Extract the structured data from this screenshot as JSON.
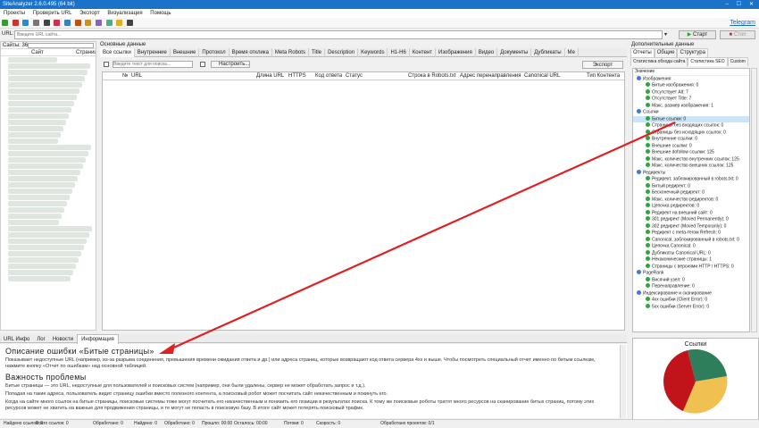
{
  "window": {
    "title": "SiteAnalyzer 2.6.0.495 (64 bit)"
  },
  "menu": [
    "Проекты",
    "Проверить URL",
    "Экспорт",
    "Визуализация",
    "Помощь"
  ],
  "toolbar": {
    "telegram": "Telegram"
  },
  "urlbar": {
    "label": "URL:",
    "placeholder": "Введите URL сайта...",
    "start": "Старт",
    "stop": "Стоп"
  },
  "sidebar": {
    "count_label": "Сайты: 36",
    "col_site": "Сайт",
    "col_pages": "Страниц"
  },
  "main": {
    "section": "Основные данные",
    "tabs": [
      "Все ссылки",
      "Внутренние",
      "Внешние",
      "Протокол",
      "Время отклика",
      "Meta Robots",
      "Title",
      "Description",
      "Keywords",
      "H1-H6",
      "Контент",
      "Изображения",
      "Видео",
      "Документы",
      "Дубликаты",
      "Ме"
    ],
    "filter_placeholder": "Введите текст для поиска...",
    "configure": "Настроить...",
    "export": "Экспорт",
    "columns": [
      "№",
      "URL",
      "Длина URL",
      "HTTPS",
      "Код ответа",
      "Статус",
      "Строка в Robots.txt",
      "Адрес перенаправления",
      "Canonical URL",
      "Тип Контента"
    ]
  },
  "right": {
    "section": "Дополнительные данные",
    "tabs1": [
      "Отчеты",
      "Общие",
      "Структура"
    ],
    "tabs2": [
      "Статистика обхода сайта",
      "Статистика SEO",
      "Custom"
    ],
    "tree_header": "Значение",
    "tree": [
      {
        "t": "Изображения",
        "lvl": 0
      },
      {
        "t": "Битые изображения: 0",
        "lvl": 1
      },
      {
        "t": "Отсутствует Alt: 7",
        "lvl": 1
      },
      {
        "t": "Отсутствует Title: 7",
        "lvl": 1
      },
      {
        "t": "Макс. размер изображения: 1",
        "lvl": 1
      },
      {
        "t": "Ссылки",
        "lvl": 0
      },
      {
        "t": "Битые ссылки: 0",
        "lvl": 1
      },
      {
        "t": "Страницы без входящих ссылок: 0",
        "lvl": 1
      },
      {
        "t": "Страницы без исходящих ссылок: 0",
        "lvl": 1
      },
      {
        "t": "Внутренние ссылки: 0",
        "lvl": 1
      },
      {
        "t": "Внешние ссылки: 0",
        "lvl": 1
      },
      {
        "t": "Внешние dofollow ссылки: 125",
        "lvl": 1
      },
      {
        "t": "Макс. количество внутренних ссылок: 125",
        "lvl": 1
      },
      {
        "t": "Макс. количество внешних ссылок: 125",
        "lvl": 1
      },
      {
        "t": "Редиректы",
        "lvl": 0
      },
      {
        "t": "Редирект, заблокированный в robots.txt: 0",
        "lvl": 1
      },
      {
        "t": "Битый редирект: 0",
        "lvl": 1
      },
      {
        "t": "Бесконечный редирект: 0",
        "lvl": 1
      },
      {
        "t": "Макс. количество редиректов: 0",
        "lvl": 1
      },
      {
        "t": "Цепочка редиректов: 0",
        "lvl": 1
      },
      {
        "t": "Редирект на внешний сайт: 0",
        "lvl": 1
      },
      {
        "t": "301 редирект (Moved Permanently): 0",
        "lvl": 1
      },
      {
        "t": "302 редирект (Moved Temporarily): 0",
        "lvl": 1
      },
      {
        "t": "Редирект с meta-тегом Refresh: 0",
        "lvl": 1
      },
      {
        "t": "Canonical, заблокированный в robots.txt: 0",
        "lvl": 1
      },
      {
        "t": "Цепочка Canonical: 0",
        "lvl": 1
      },
      {
        "t": "Дубликаты Canonical URL: 0",
        "lvl": 1
      },
      {
        "t": "Некаконические страницы: 1",
        "lvl": 1
      },
      {
        "t": "Страницы с версиями HTTP / HTTPS: 0",
        "lvl": 1
      },
      {
        "t": "PageRank",
        "lvl": 0
      },
      {
        "t": "Висячий узел: 0",
        "lvl": 1
      },
      {
        "t": "Перенаправление: 0",
        "lvl": 1
      },
      {
        "t": "Индексирование и сканирование",
        "lvl": 0
      },
      {
        "t": "4xx ошибки (Client Error): 0",
        "lvl": 1
      },
      {
        "t": "5xx ошибки (Server Error): 0",
        "lvl": 1
      }
    ],
    "pie_title": "Ссылки",
    "pie_colors": [
      "#2e7d5b",
      "#f0c050",
      "#c0141a"
    ]
  },
  "bottom": {
    "tabs": [
      "URL Инфо",
      "Лог",
      "Новости",
      "Информация"
    ],
    "heading1": "Описание ошибки «Битые страницы»",
    "para1": "Показывает недоступные URL (например, из-за разрыва соединения, превышения времени ожидания ответа и др.) или адреса страниц, которые возвращают код ответа сервера 4xx и выше. Чтобы посмотреть специальный отчет именно по битым ссылкам, нажмите кнопку «Отчет по ошибкам» над основной таблицей.",
    "heading2": "Важность проблемы",
    "para2": "Битые страницы — это URL, недоступные для пользователей и поисковых систем (например, они были удалены, сервер не может обработать запрос и т.д.).",
    "para3": "Попадая на такие адреса, пользователь видит страницу ошибки вместо полезного контента, а поисковый робот может посчитать сайт некачественным и покинуть его.",
    "para4": "Когда на сайте много ссылок на битые страницы, поисковые системы тоже могут посчитать его некачественным и понизить его позиции в результатах поиска. К тому же поисковые роботы тратят много ресурсов на сканирование битых страниц, потому этих ресурсов может не хватить на важные для продвижения страницы, и те могут не попасть в поисковую базу. В итоге сайт может потерять поисковый трафик."
  },
  "status": [
    "Найдено ссылок: 0",
    "Всего ссылок: 0",
    "Обработано: 0",
    "Найдено: 0",
    "Обработано: 0",
    "Прошло: 00:00",
    "Осталось: 00:00",
    "Потоки: 0",
    "Скорость: 0",
    "Обработано проектов: 0/1"
  ]
}
